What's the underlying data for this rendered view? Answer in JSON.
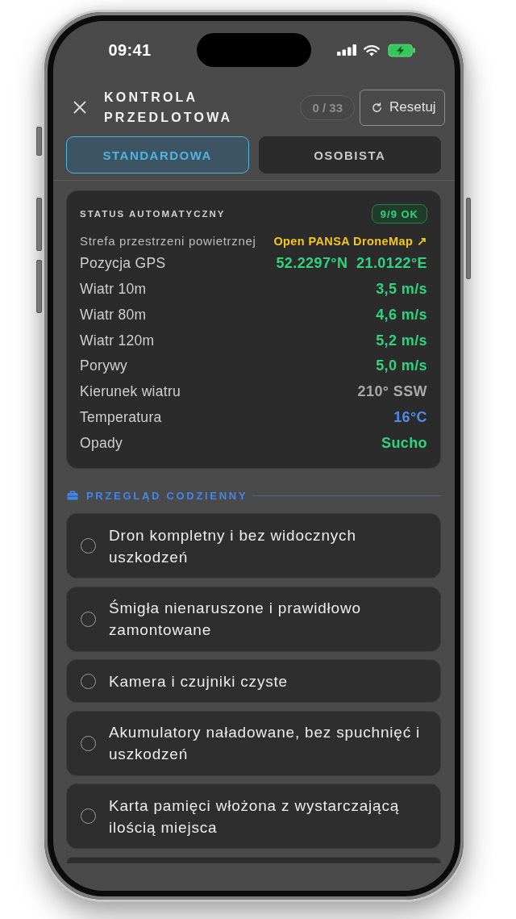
{
  "status_bar": {
    "time": "09:41",
    "battery_charging": true
  },
  "header": {
    "title": "KONTROLA PRZEDLOTOWA",
    "progress": "0 / 33",
    "reset_label": "Resetuj"
  },
  "tabs": [
    {
      "label": "STANDARDOWA",
      "selected": true
    },
    {
      "label": "OSOBISTA",
      "selected": false
    }
  ],
  "auto_status": {
    "title": "STATUS AUTOMATYCZNY",
    "badge": {
      "text": "9/9 OK",
      "ok": true
    },
    "rows": [
      {
        "label": "Strefa przestrzeni powietrznej",
        "value": "Open PANSA DroneMap ↗",
        "kind": "link",
        "color": "#f2c718"
      },
      {
        "label": "Pozycja GPS",
        "value": "52.2297°N  21.0122°E",
        "kind": "reading",
        "color": "#2fd37e"
      },
      {
        "label": "Wiatr 10m",
        "value": "3,5 m/s",
        "kind": "reading",
        "color": "#2fd37e"
      },
      {
        "label": "Wiatr 80m",
        "value": "4,6 m/s",
        "kind": "reading",
        "color": "#2fd37e"
      },
      {
        "label": "Wiatr 120m",
        "value": "5,2 m/s",
        "kind": "reading",
        "color": "#2fd37e"
      },
      {
        "label": "Porywy",
        "value": "5,0 m/s",
        "kind": "reading",
        "color": "#2fd37e"
      },
      {
        "label": "Kierunek wiatru",
        "value": "210° SSW",
        "kind": "reading",
        "color": "#a9a9a9"
      },
      {
        "label": "Temperatura",
        "value": "16°C",
        "kind": "reading",
        "color": "#4b8de8"
      },
      {
        "label": "Opady",
        "value": "Sucho",
        "kind": "reading",
        "color": "#2fd37e"
      }
    ]
  },
  "checklist": {
    "title": "PRZEGLĄD CODZIENNY",
    "items": [
      {
        "text": "Dron kompletny i bez widocznych uszkodzeń",
        "checked": false
      },
      {
        "text": "Śmigła nienaruszone i prawidłowo zamontowane",
        "checked": false
      },
      {
        "text": "Kamera i czujniki czyste",
        "checked": false
      },
      {
        "text": "Akumulatory naładowane, bez spuchnięć i uszkodzeń",
        "checked": false
      },
      {
        "text": "Karta pamięci włożona z wystarczającą ilością miejsca",
        "checked": false
      }
    ],
    "more_below": true
  }
}
